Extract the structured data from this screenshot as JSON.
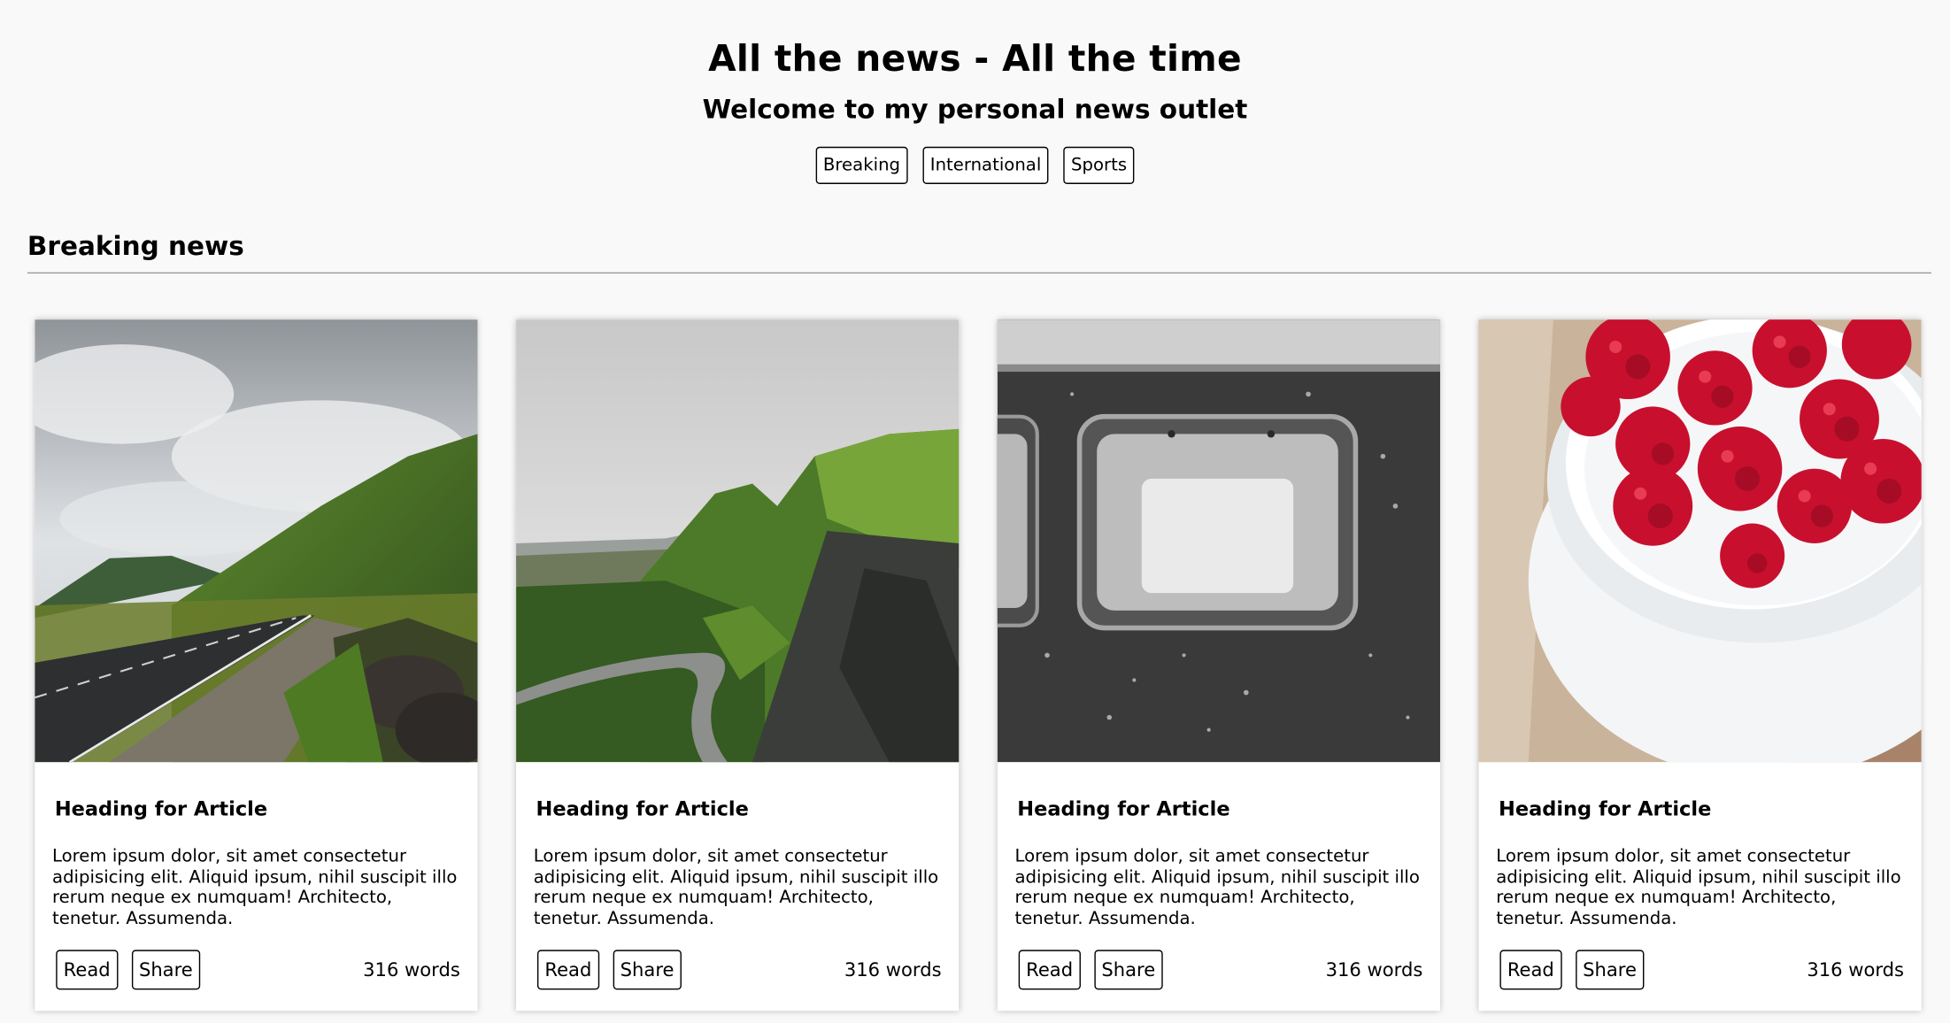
{
  "header": {
    "title": "All the news - All the time",
    "subtitle": "Welcome to my personal news outlet"
  },
  "nav": {
    "buttons": [
      "Breaking",
      "International",
      "Sports"
    ]
  },
  "section": {
    "title": "Breaking news"
  },
  "cards": [
    {
      "image_icon": "mountain-road-photo",
      "heading": "Heading for Article",
      "text": "Lorem ipsum dolor, sit amet consectetur adipisicing elit. Aliquid ipsum, nihil suscipit illo rerum neque ex numquam! Architecto, tenetur. Assumenda.",
      "read_label": "Read",
      "share_label": "Share",
      "words": "316 words"
    },
    {
      "image_icon": "valley-road-photo",
      "heading": "Heading for Article",
      "text": "Lorem ipsum dolor, sit amet consectetur adipisicing elit. Aliquid ipsum, nihil suscipit illo rerum neque ex numquam! Architecto, tenetur. Assumenda.",
      "read_label": "Read",
      "share_label": "Share",
      "words": "316 words"
    },
    {
      "image_icon": "train-window-photo",
      "heading": "Heading for Article",
      "text": "Lorem ipsum dolor, sit amet consectetur adipisicing elit. Aliquid ipsum, nihil suscipit illo rerum neque ex numquam! Architecto, tenetur. Assumenda.",
      "read_label": "Read",
      "share_label": "Share",
      "words": "316 words"
    },
    {
      "image_icon": "raspberries-bowl-photo",
      "heading": "Heading for Article",
      "text": "Lorem ipsum dolor, sit amet consectetur adipisicing elit. Aliquid ipsum, nihil suscipit illo rerum neque ex numquam! Architecto, tenetur. Assumenda.",
      "read_label": "Read",
      "share_label": "Share",
      "words": "316 words"
    }
  ]
}
